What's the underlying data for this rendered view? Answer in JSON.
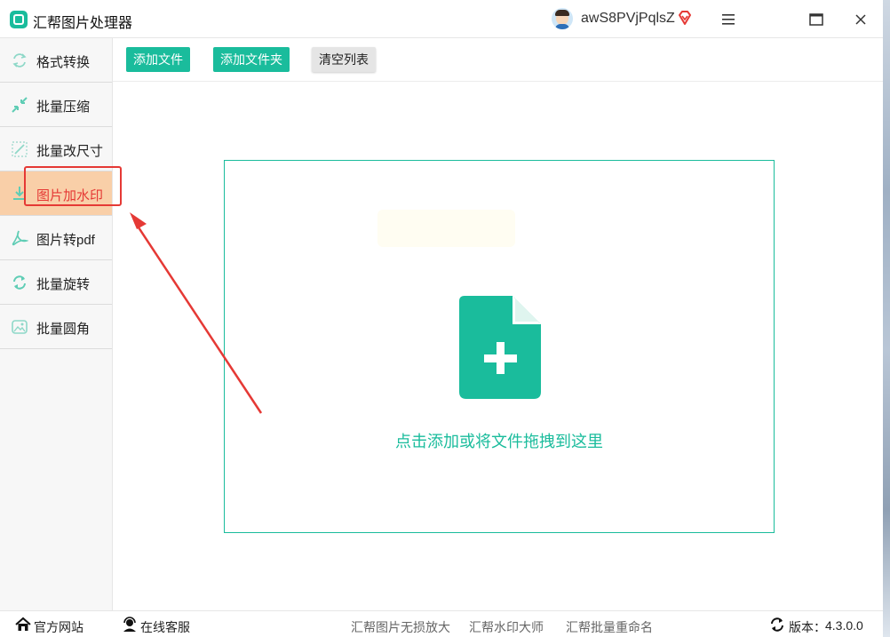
{
  "app": {
    "title": "汇帮图片处理器"
  },
  "user": {
    "name": "awS8PVjPqlsZ"
  },
  "sidebar": {
    "items": [
      {
        "label": "格式转换",
        "icon": "format-convert-icon"
      },
      {
        "label": "批量压缩",
        "icon": "compress-icon"
      },
      {
        "label": "批量改尺寸",
        "icon": "resize-icon"
      },
      {
        "label": "图片加水印",
        "icon": "watermark-icon",
        "active": true
      },
      {
        "label": "图片转pdf",
        "icon": "pdf-icon"
      },
      {
        "label": "批量旋转",
        "icon": "rotate-icon"
      },
      {
        "label": "批量圆角",
        "icon": "round-corner-icon"
      }
    ]
  },
  "toolbar": {
    "add_file": "添加文件",
    "add_folder": "添加文件夹",
    "clear_list": "清空列表"
  },
  "dropzone": {
    "hint": "点击添加或将文件拖拽到这里"
  },
  "statusbar": {
    "website": "官方网站",
    "support": "在线客服",
    "links": [
      "汇帮图片无损放大",
      "汇帮水印大师",
      "汇帮批量重命名"
    ],
    "version_label": "版本：",
    "version": "4.3.0.0"
  },
  "colors": {
    "accent": "#1abc9c",
    "active_bg": "#f9cfa8",
    "annotation": "#e53935"
  }
}
